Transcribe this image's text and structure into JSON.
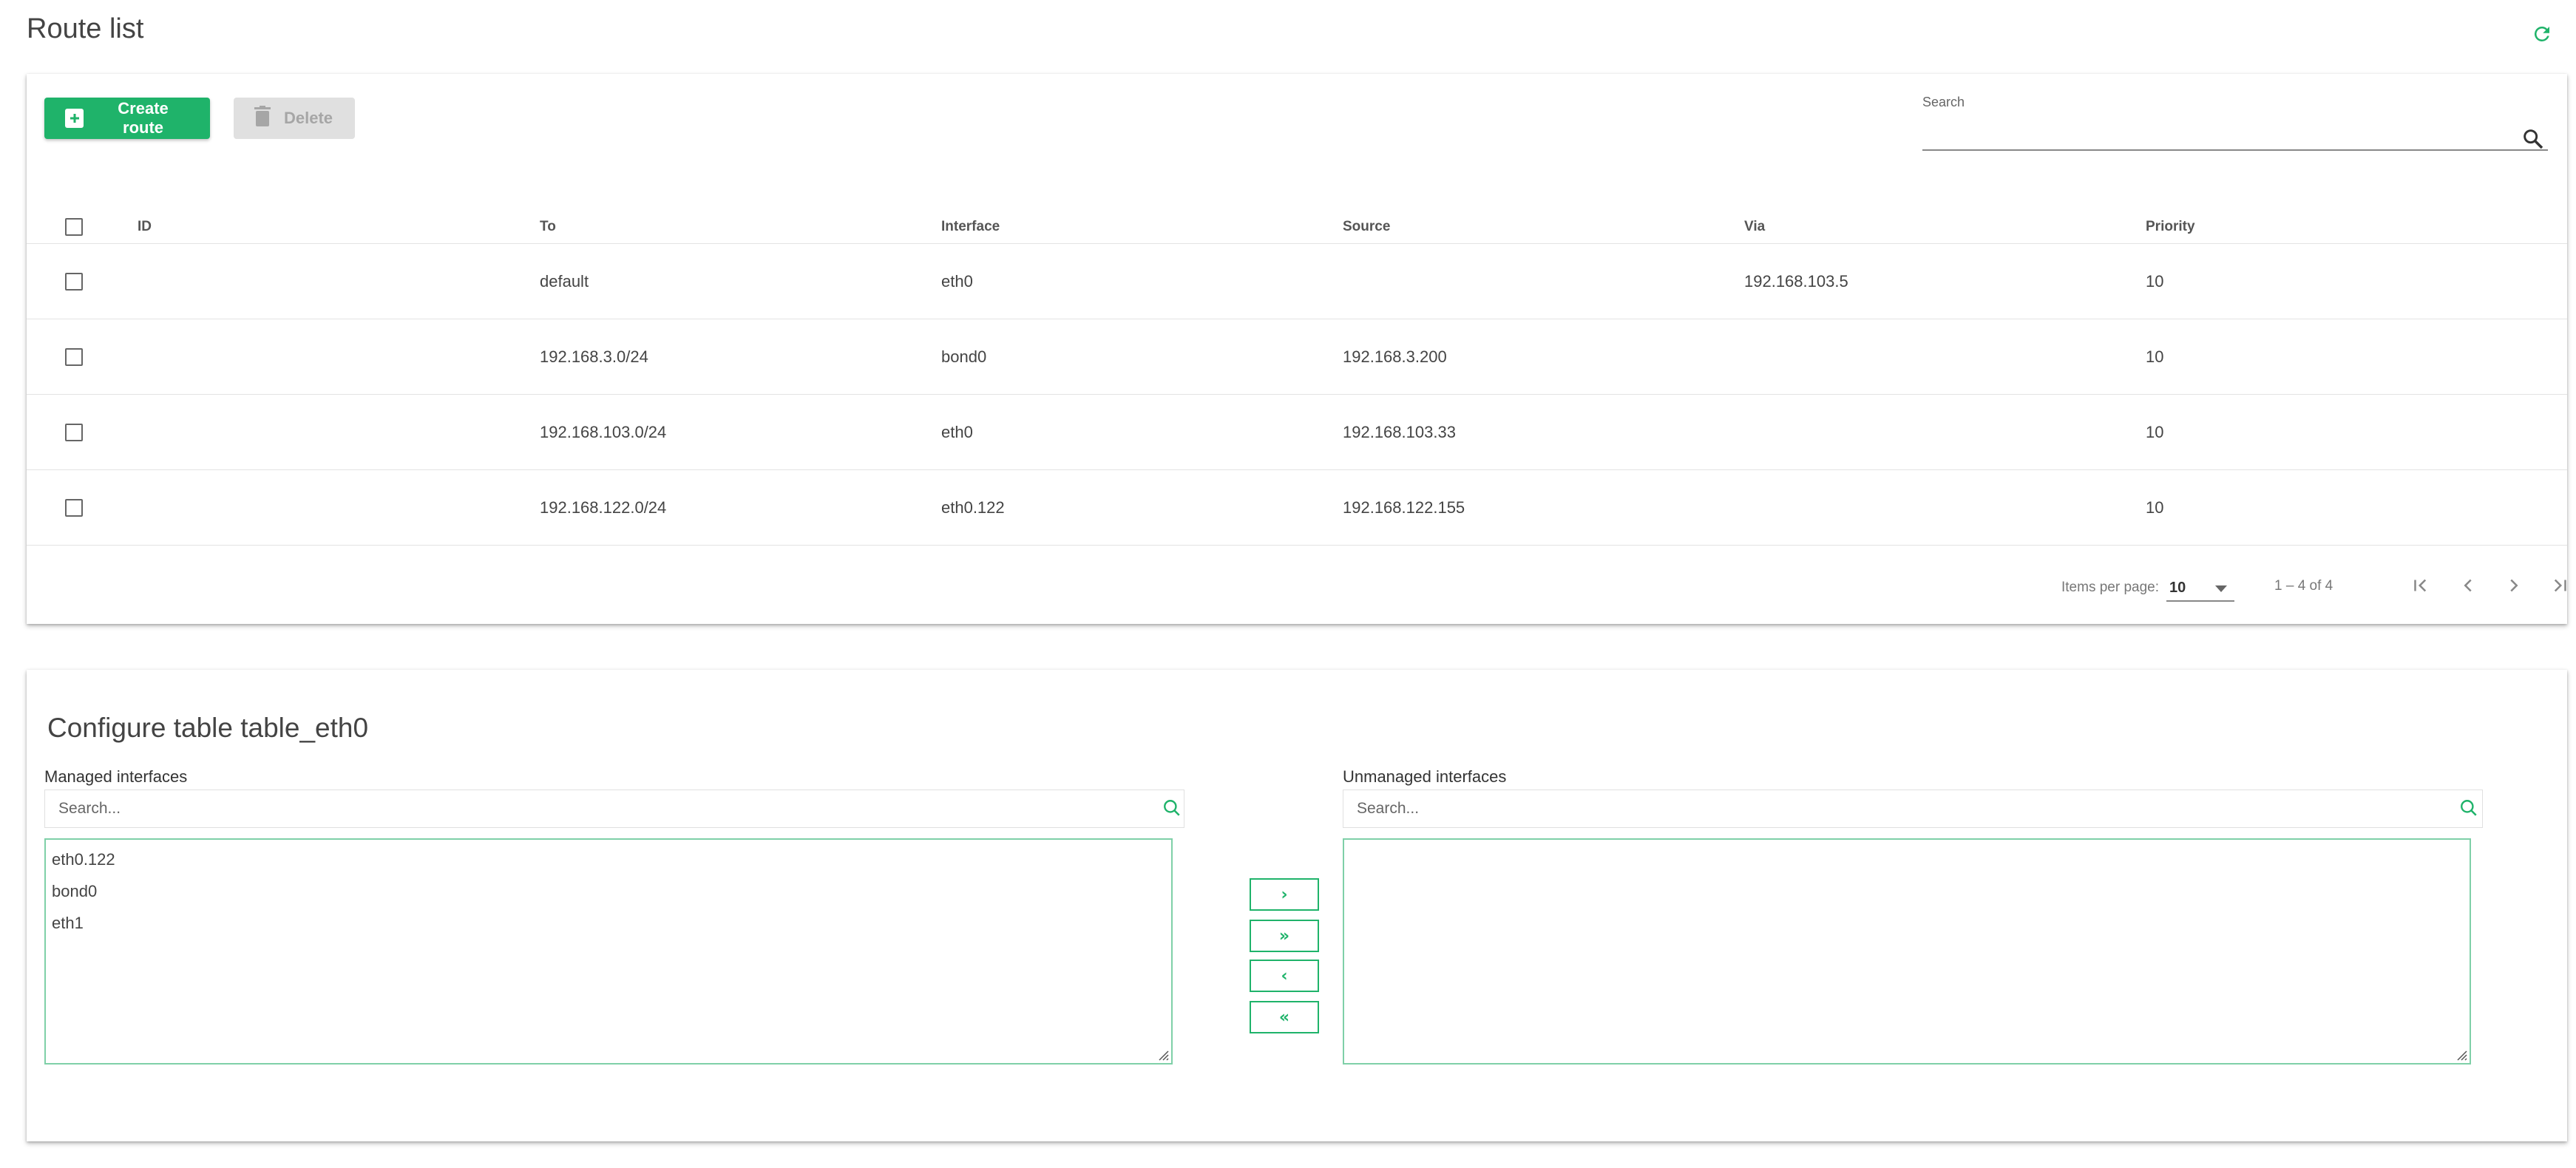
{
  "page": {
    "title": "Route list"
  },
  "toolbar": {
    "create_label": "Create route",
    "delete_label": "Delete",
    "search_label": "Search",
    "search_value": ""
  },
  "table": {
    "headers": {
      "id": "ID",
      "to": "To",
      "interface": "Interface",
      "source": "Source",
      "via": "Via",
      "priority": "Priority"
    },
    "rows": [
      {
        "id": "",
        "to": "default",
        "interface": "eth0",
        "source": "",
        "via": "192.168.103.5",
        "priority": "10"
      },
      {
        "id": "",
        "to": "192.168.3.0/24",
        "interface": "bond0",
        "source": "192.168.3.200",
        "via": "",
        "priority": "10"
      },
      {
        "id": "",
        "to": "192.168.103.0/24",
        "interface": "eth0",
        "source": "192.168.103.33",
        "via": "",
        "priority": "10"
      },
      {
        "id": "",
        "to": "192.168.122.0/24",
        "interface": "eth0.122",
        "source": "192.168.122.155",
        "via": "",
        "priority": "10"
      }
    ]
  },
  "paginator": {
    "items_per_page_label": "Items per page:",
    "items_per_page": "10",
    "range": "1 – 4 of 4"
  },
  "config": {
    "title": "Configure table table_eth0",
    "managed": {
      "label": "Managed interfaces",
      "search_placeholder": "Search...",
      "items": [
        "eth0.122",
        "bond0",
        "eth1"
      ]
    },
    "unmanaged": {
      "label": "Unmanaged interfaces",
      "search_placeholder": "Search...",
      "items": []
    },
    "move_buttons": {
      "right": "›",
      "all_right": "»",
      "left": "‹",
      "all_left": "«"
    }
  },
  "colors": {
    "accent": "#1fb36a",
    "disabled_bg": "#e0e0e0",
    "disabled_text": "#a6a6a6",
    "list_border": "#7fd0a8"
  },
  "icons": {
    "refresh": "refresh-icon",
    "create": "plus-box-icon",
    "delete": "trash-icon",
    "search": "search-icon",
    "first_page": "first-page-icon",
    "prev_page": "chevron-left-icon",
    "next_page": "chevron-right-icon",
    "last_page": "last-page-icon"
  }
}
